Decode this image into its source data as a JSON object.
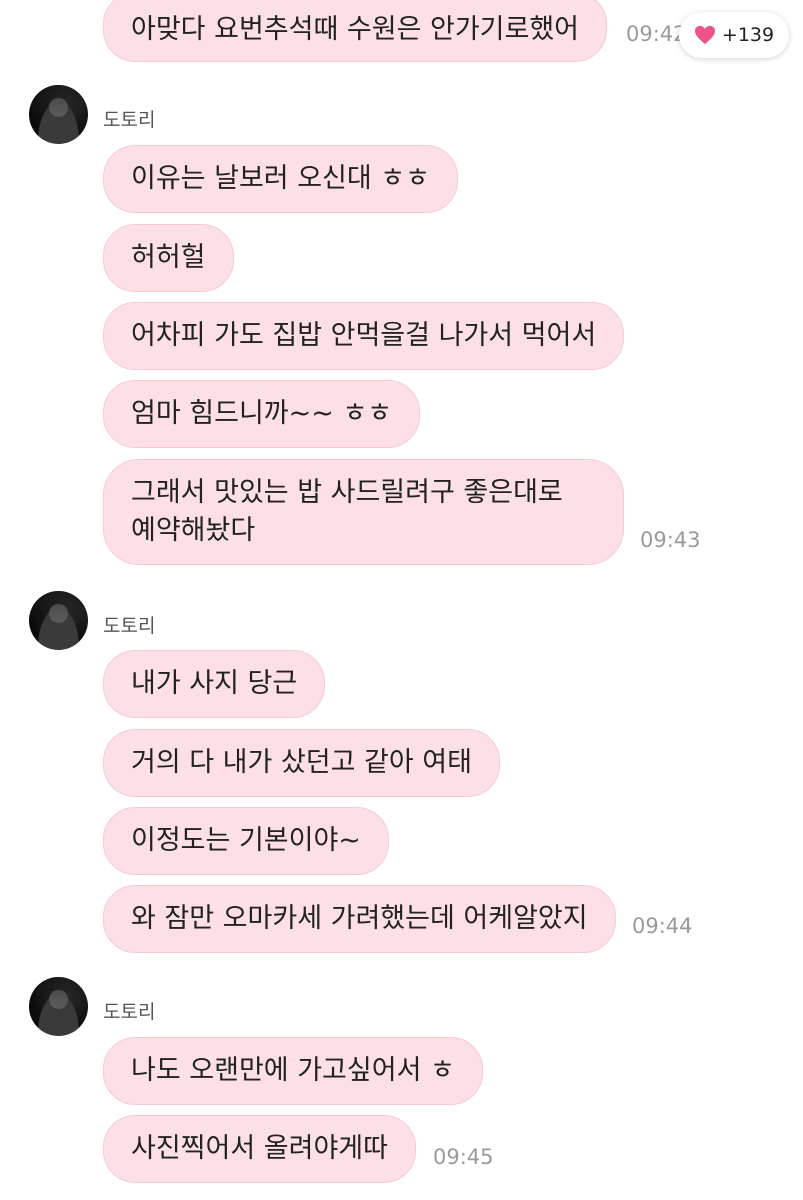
{
  "reaction": {
    "icon": "heart-icon",
    "count": "+139",
    "color": "#f0538a"
  },
  "colors": {
    "bubble": "#fde0e6",
    "bubble_border": "#f6cbd4",
    "time": "#9a9a9a"
  },
  "messages": {
    "m0": {
      "text": "아맞다 요번추석때 수원은 안가기로했어",
      "time": "09:42"
    },
    "group1": {
      "sender": "도토리",
      "m1": "이유는 날보러 오신대 ㅎㅎ",
      "m2": "허허헐",
      "m3": "어차피 가도 집밥 안먹을걸 나가서 먹어서",
      "m4": "엄마 힘드니까~~ ㅎㅎ",
      "m5": "그래서 맛있는 밥 사드릴려구 좋은대로 예약해놨다",
      "time": "09:43"
    },
    "group2": {
      "sender": "도토리",
      "m1": "내가 사지 당근",
      "m2": "거의 다 내가 샀던고 같아 여태",
      "m3": "이정도는 기본이야~",
      "m4": "와 잠만 오마카세 가려했는데 어케알았지",
      "time": "09:44"
    },
    "group3": {
      "sender": "도토리",
      "m1": "나도 오랜만에 가고싶어서 ㅎ",
      "m2": "사진찍어서 올려야게따",
      "time": "09:45"
    }
  }
}
